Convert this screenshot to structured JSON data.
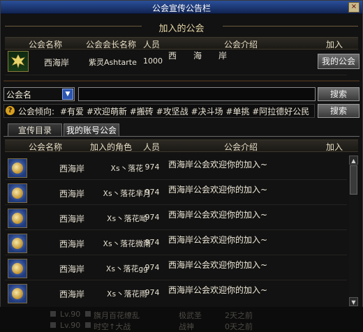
{
  "window": {
    "title": "公会宣传公告栏",
    "close": "×"
  },
  "joined": {
    "title": "加入的公会",
    "headers": {
      "name": "公会名称",
      "leader": "公会会长名称",
      "members": "人员",
      "intro": "公会介绍",
      "join": "加入"
    },
    "row": {
      "name": "西海岸",
      "leader": "紫灵Ashtarte",
      "members": "1000",
      "intro": "西　　海　　岸",
      "button": "我的公会"
    }
  },
  "search": {
    "select_value": "公会名",
    "input_value": "",
    "button": "搜索",
    "tendency_label": "公会倾向:",
    "tendency_tags": "#有爱 #欢迎萌新 #搬砖 #攻坚战 #决斗场 #单挑 #阿拉德好公民",
    "tendency_button": "搜索"
  },
  "tabs": [
    {
      "label": "宣传目录"
    },
    {
      "label": "我的账号公会"
    }
  ],
  "list": {
    "headers": {
      "name": "公会名称",
      "role": "加入的角色",
      "members": "人员",
      "intro": "公会介绍",
      "join": "加入"
    },
    "rows": [
      {
        "name": "西海岸",
        "role": "Xs丶落花",
        "members": "974",
        "intro": "西海岸公会欢迎你的加入~"
      },
      {
        "name": "西海岸",
        "role": "Xs丶落花芈月",
        "members": "974",
        "intro": "西海岸公会欢迎你的加入~"
      },
      {
        "name": "西海岸",
        "role": "Xs丶落花呦",
        "members": "974",
        "intro": "西海岸公会欢迎你的加入~"
      },
      {
        "name": "西海岸",
        "role": "Xs丶落花微雨",
        "members": "974",
        "intro": "西海岸公会欢迎你的加入~"
      },
      {
        "name": "西海岸",
        "role": "Xs丶落花gg",
        "members": "974",
        "intro": "西海岸公会欢迎你的加入~"
      },
      {
        "name": "西海岸",
        "role": "Xs丶落花雨",
        "members": "974",
        "intro": "西海岸公会欢迎你的加入~"
      }
    ]
  },
  "background": {
    "line1": {
      "level": "Lv.90",
      "name": "旗月百花缭乱",
      "job": "极武圣",
      "days": "2天之前"
    },
    "line2": {
      "level": "Lv.90",
      "name": "时空↑大战",
      "job": "战神",
      "days": "0天之前"
    }
  },
  "colors": {
    "titlebar": "#1c3670",
    "header": "#2d2a24",
    "accent": "#2b55b0"
  }
}
